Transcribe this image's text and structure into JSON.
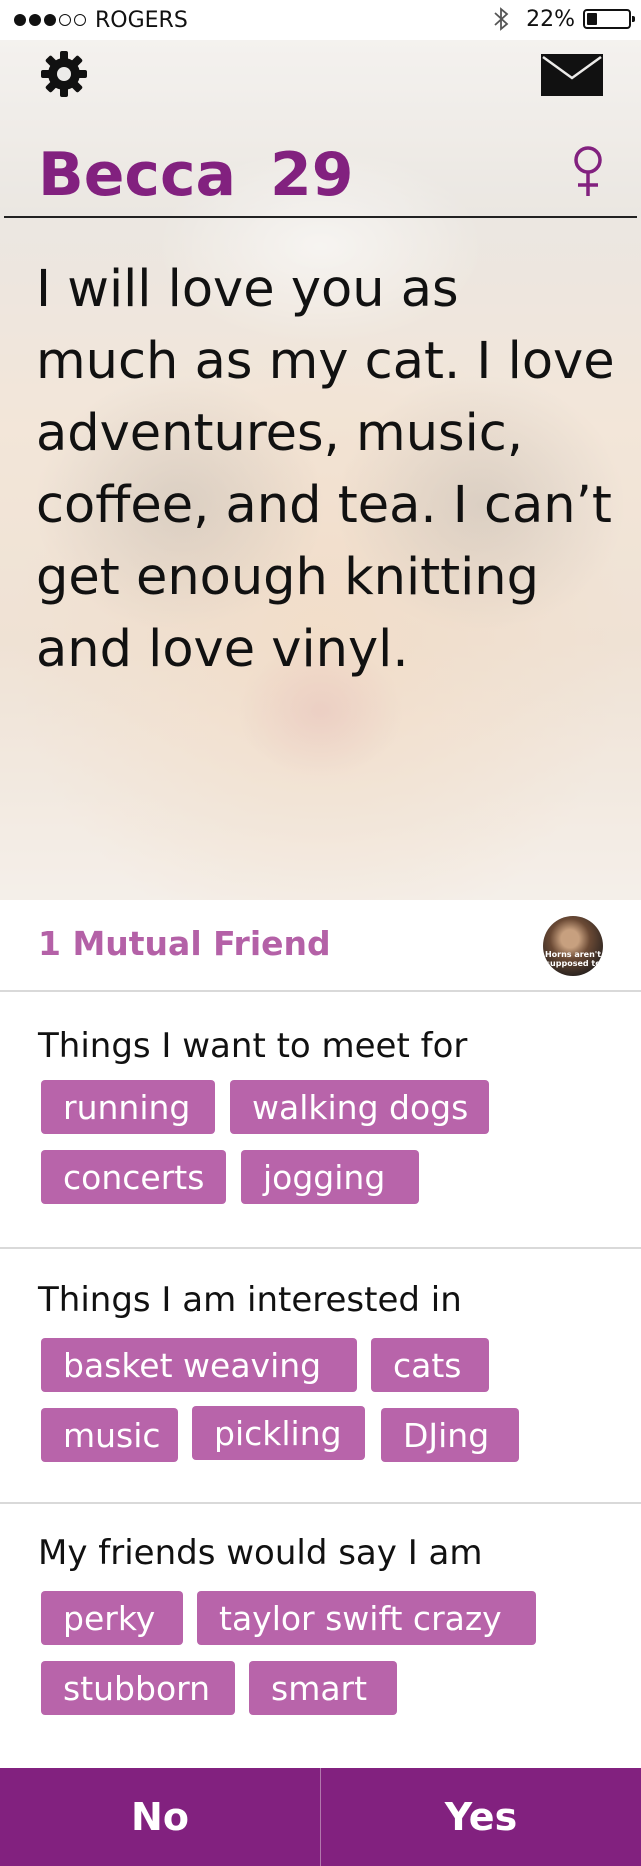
{
  "status_bar": {
    "carrier": "ROGERS",
    "battery_percent": "22%",
    "battery_level": 0.22,
    "signal_bars_filled": 3,
    "signal_bars_total": 5
  },
  "profile": {
    "name": "Becca",
    "age": "29",
    "bio": "I will love you as much as my cat. I love adventures, music, coffee, and tea. I can’t get enough knitting and love vinyl.",
    "avatar_caption": "Horns aren't supposed to"
  },
  "mutual_friends": {
    "label": "1 Mutual Friend"
  },
  "sections": {
    "meet_for": {
      "title": "Things I want to meet for",
      "tags": [
        "running",
        "walking dogs",
        "concerts",
        "jogging"
      ]
    },
    "interests": {
      "title": "Things I am interested in",
      "tags": [
        "basket weaving",
        "cats",
        "music",
        "pickling",
        "DJing"
      ]
    },
    "friends_say": {
      "title": "My friends would say I am",
      "tags": [
        "perky",
        "taylor swift crazy",
        "stubborn",
        "smart"
      ]
    }
  },
  "actions": {
    "no_label": "No",
    "yes_label": "Yes"
  },
  "colors": {
    "accent": "#82217f",
    "tag_bg": "#b864aa",
    "mutual_text": "#b461a7"
  },
  "icons": {
    "settings": "gear-icon",
    "mail": "envelope-icon",
    "gender": "female-icon",
    "bluetooth": "bluetooth-icon",
    "battery": "battery-icon"
  }
}
